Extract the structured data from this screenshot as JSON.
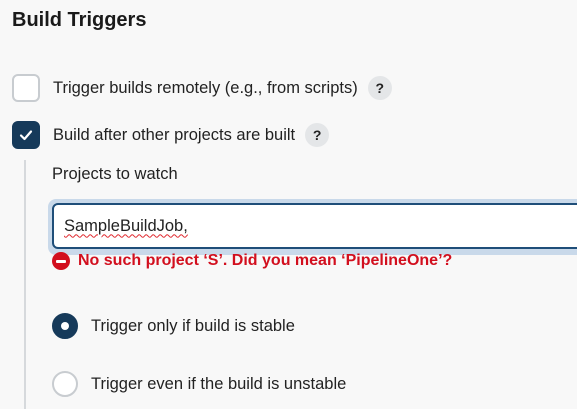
{
  "section": {
    "title": "Build Triggers"
  },
  "triggers": {
    "remote": {
      "label": "Trigger builds remotely (e.g., from scripts)",
      "checked": false,
      "help": "?"
    },
    "after_other": {
      "label": "Build after other projects are built",
      "checked": true,
      "help": "?"
    }
  },
  "projects_to_watch": {
    "label": "Projects to watch",
    "value": "SampleBuildJob,",
    "error": "No such project ‘S’. Did you mean ‘PipelineOne’?"
  },
  "stability": {
    "options": [
      {
        "label": "Trigger only if build is stable",
        "selected": true
      },
      {
        "label": "Trigger even if the build is unstable",
        "selected": false
      }
    ]
  },
  "colors": {
    "accent": "#163a5a",
    "error": "#d20f1e",
    "focus_ring": "#c9d9ea"
  }
}
